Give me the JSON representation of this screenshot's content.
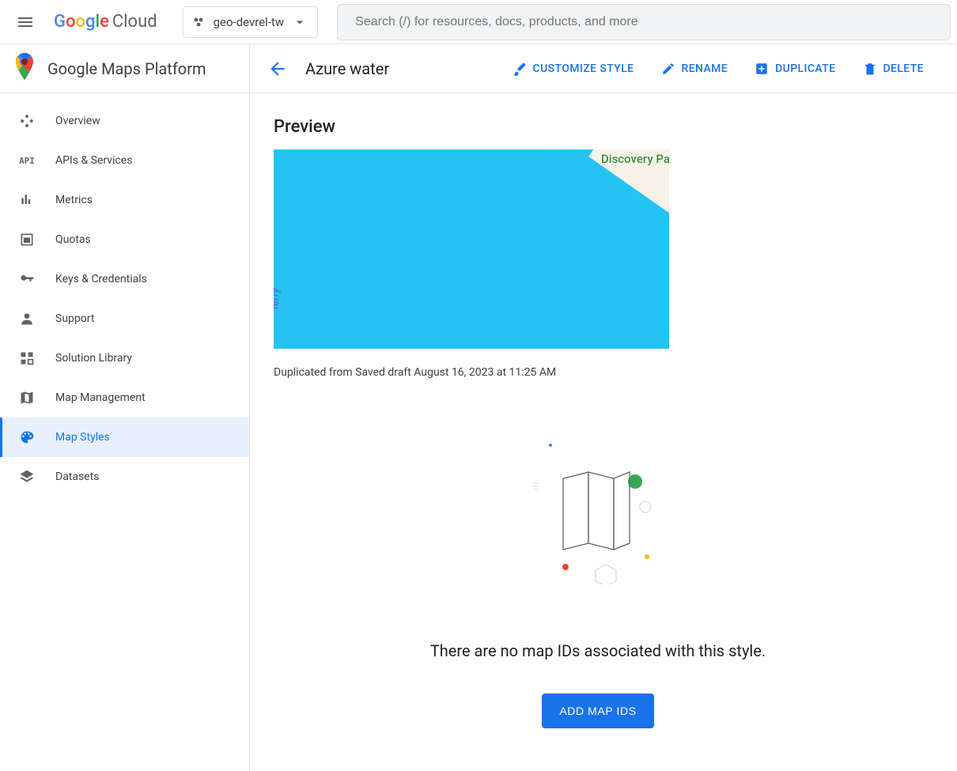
{
  "brand": {
    "cloud_label": "Cloud"
  },
  "project": {
    "name": "geo-devrel-tw"
  },
  "search": {
    "placeholder": "Search (/) for resources, docs, products, and more"
  },
  "sidebar": {
    "title": "Google Maps Platform",
    "items": [
      {
        "label": "Overview"
      },
      {
        "label": "APIs & Services"
      },
      {
        "label": "Metrics"
      },
      {
        "label": "Quotas"
      },
      {
        "label": "Keys & Credentials"
      },
      {
        "label": "Support"
      },
      {
        "label": "Solution Library"
      },
      {
        "label": "Map Management"
      },
      {
        "label": "Map Styles"
      },
      {
        "label": "Datasets"
      }
    ]
  },
  "page": {
    "title": "Azure water",
    "actions": {
      "customize": "CUSTOMIZE STYLE",
      "rename": "RENAME",
      "duplicate": "DUPLICATE",
      "delete": "DELETE"
    },
    "preview": {
      "heading": "Preview",
      "park_label": "Discovery Pa",
      "ferry_label": "ferry",
      "caption": "Duplicated from Saved draft August 16, 2023 at 11:25 AM"
    },
    "empty_state": {
      "message": "There are no map IDs associated with this style.",
      "cta": "ADD MAP IDS"
    }
  }
}
